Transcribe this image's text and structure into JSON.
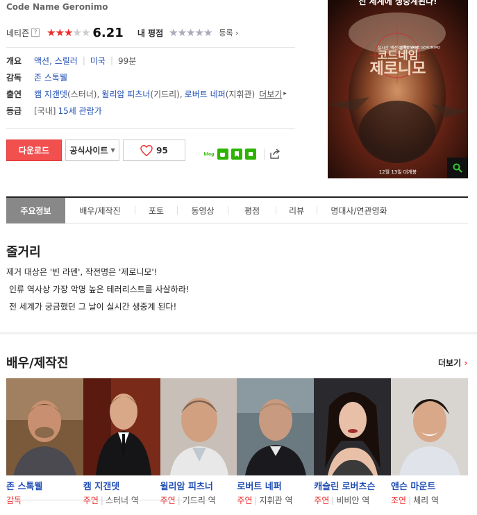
{
  "movie": {
    "original_title": "Code Name Geronimo"
  },
  "rating": {
    "label": "네티즌",
    "help": "?",
    "score": "6.21",
    "stars_filled": 3,
    "stars_total": 5,
    "my_rating_label": "내 평점",
    "register_label": "등록 ›"
  },
  "info": {
    "overview_label": "개요",
    "genre": "액션, 스릴러",
    "country": "미국",
    "runtime": "99분",
    "director_label": "감독",
    "director": "존 스톡웰",
    "cast_label": "출연",
    "cast_1_name": "캠 지갠뎃",
    "cast_1_role": "(스터너),",
    "cast_2_name": "윌리암 피츠너",
    "cast_2_role": "(기드리),",
    "cast_3_name": "로버트 네퍼",
    "cast_3_role": "(지휘관)",
    "cast_more": "더보기",
    "rating_label": "등급",
    "rating_region": "[국내]",
    "rating_value": "15세 관람가"
  },
  "buttons": {
    "download": "다운로드",
    "official_site": "공식사이트",
    "like_count": "95"
  },
  "share": {
    "blog_label": "blog"
  },
  "poster": {
    "top_text": "전 세계에 생중계된다!",
    "small_text": "실시간 액션 블록버스터",
    "title_1": "코드네임",
    "title_2": "제로니모",
    "english_title": "CODE NAME GERONIMO",
    "release_text": "12월 13일 대개봉"
  },
  "tabs": [
    "주요정보",
    "배우/제작진",
    "포토",
    "동영상",
    "평점",
    "리뷰",
    "명대사/연관영화"
  ],
  "synopsis": {
    "title": "줄거리",
    "lines": [
      "제거 대상은 '빈 라덴', 작전명은 '제로니모'!",
      "인류 역사상 가장 악명 높은 테러리스트를 사살하라!",
      "전 세계가 궁금했던 그 날이 실시간 생중계 된다!"
    ]
  },
  "cast_section": {
    "title": "배우/제작진",
    "more": "더보기",
    "more_arrow": "›",
    "people": [
      {
        "name": "존 스톡웰",
        "type": "감독",
        "role": ""
      },
      {
        "name": "캠 지갠뎃",
        "type": "주연",
        "role": "스터너 역"
      },
      {
        "name": "윌리암 피츠너",
        "type": "주연",
        "role": "기드리 역"
      },
      {
        "name": "로버트 네퍼",
        "type": "주연",
        "role": "지휘관 역"
      },
      {
        "name": "캐슬린 로버츠슨",
        "type": "주연",
        "role": "비비안 역"
      },
      {
        "name": "앤슨 마운트",
        "type": "조연",
        "role": "체리 역"
      }
    ]
  },
  "colors": {
    "accent_red": "#f24f4f",
    "link_blue": "#1f4db4",
    "tab_active": "#888888"
  }
}
